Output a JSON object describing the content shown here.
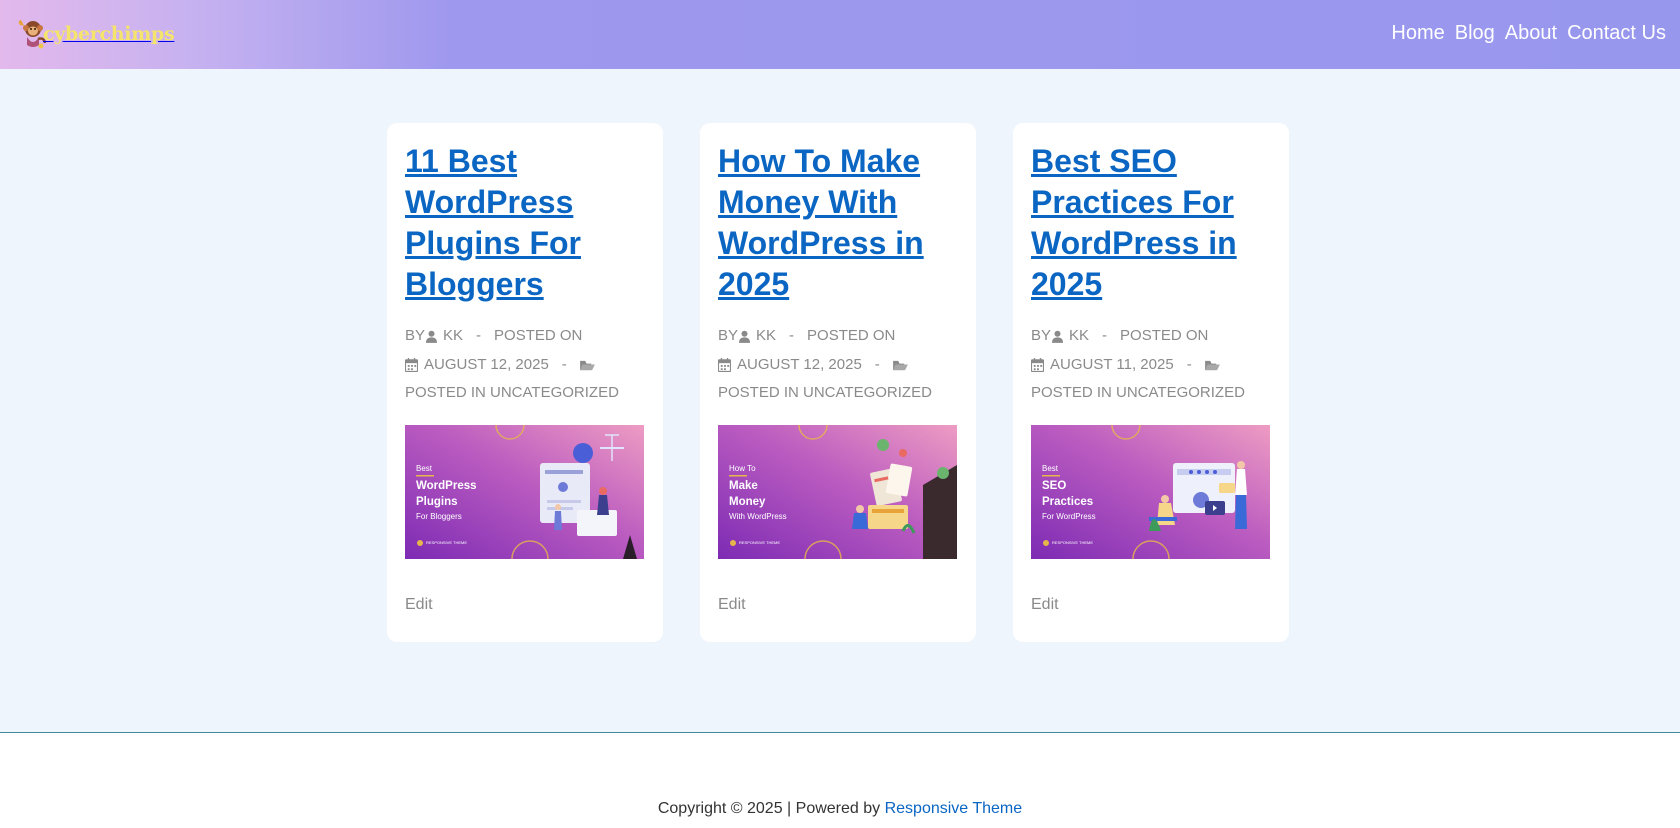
{
  "header": {
    "logo_text": "cyberchimps",
    "nav": [
      "Home",
      "Blog",
      "About",
      "Contact Us"
    ]
  },
  "posts": [
    {
      "title": "11 Best WordPress Plugins For Bloggers",
      "by_label": "BY",
      "author": "KK",
      "posted_on_label": "POSTED ON",
      "date": "AUGUST 12, 2025",
      "category_label": "POSTED IN UNCATEGORIZED",
      "thumb": {
        "line1": "Best",
        "line2": "WordPress",
        "line3": "Plugins",
        "line4": "For Bloggers",
        "brand": "RESPONSIVE THEME"
      },
      "edit_label": "Edit"
    },
    {
      "title": "How To Make Money With WordPress in 2025",
      "by_label": "BY",
      "author": "KK",
      "posted_on_label": "POSTED ON",
      "date": "AUGUST 12, 2025",
      "category_label": "POSTED IN UNCATEGORIZED",
      "thumb": {
        "line1": "How To",
        "line2": "Make",
        "line3": "Money",
        "line4": "With WordPress",
        "brand": "RESPONSIVE THEME"
      },
      "edit_label": "Edit"
    },
    {
      "title": "Best SEO Practices For WordPress in 2025",
      "by_label": "BY",
      "author": "KK",
      "posted_on_label": "POSTED ON",
      "date": "AUGUST 11, 2025",
      "category_label": "POSTED IN UNCATEGORIZED",
      "thumb": {
        "line1": "Best",
        "line2": "SEO",
        "line3": "Practices",
        "line4": "For WordPress",
        "brand": "RESPONSIVE THEME"
      },
      "edit_label": "Edit"
    }
  ],
  "footer": {
    "copyright_prefix": "Copyright © 2025 | Powered by",
    "link_text": "Responsive Theme"
  },
  "colors": {
    "title_blue": "#0a66c2",
    "meta_gray": "#8a8a8a",
    "page_bg": "#eff5fc",
    "header_purple": "#9897ee",
    "logo_yellow": "#f4e46b"
  }
}
